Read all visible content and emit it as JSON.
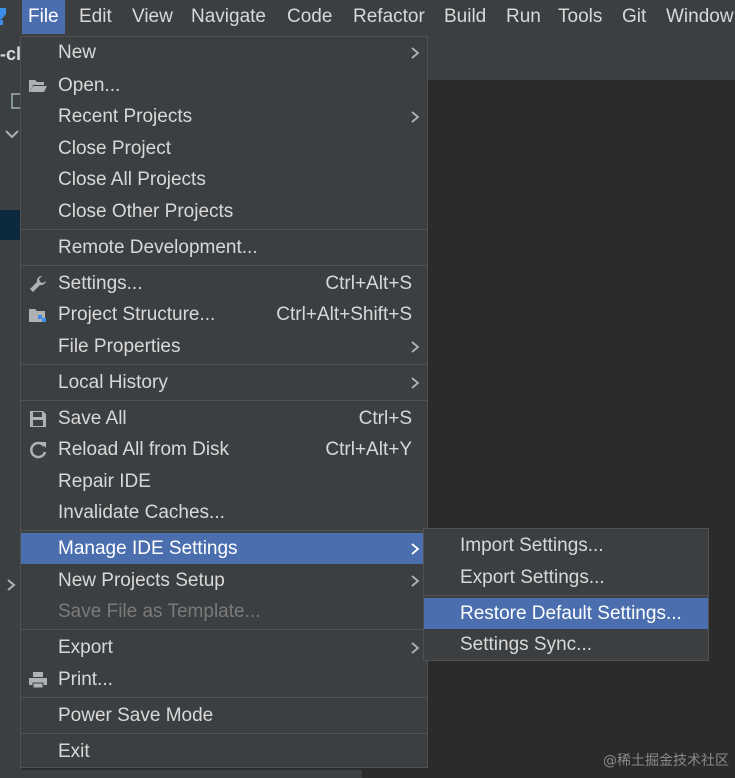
{
  "menubar": {
    "items": [
      {
        "label": "File",
        "active": true
      },
      {
        "label": "Edit"
      },
      {
        "label": "View"
      },
      {
        "label": "Navigate"
      },
      {
        "label": "Code"
      },
      {
        "label": "Refactor"
      },
      {
        "label": "Build"
      },
      {
        "label": "Run"
      },
      {
        "label": "Tools"
      },
      {
        "label": "Git"
      },
      {
        "label": "Window"
      }
    ]
  },
  "project": {
    "label": "-cl"
  },
  "file_menu": {
    "items": [
      {
        "label": "New",
        "submenu": true
      },
      {
        "label": "Open...",
        "icon": "folder-open-icon"
      },
      {
        "label": "Recent Projects",
        "submenu": true
      },
      {
        "label": "Close Project"
      },
      {
        "label": "Close All Projects"
      },
      {
        "label": "Close Other Projects"
      },
      {
        "label": "Remote Development..."
      },
      {
        "label": "Settings...",
        "shortcut": "Ctrl+Alt+S",
        "icon": "wrench-icon"
      },
      {
        "label": "Project Structure...",
        "shortcut": "Ctrl+Alt+Shift+S",
        "icon": "project-structure-icon"
      },
      {
        "label": "File Properties",
        "submenu": true
      },
      {
        "label": "Local History",
        "submenu": true
      },
      {
        "label": "Save All",
        "shortcut": "Ctrl+S",
        "icon": "floppy-disk-icon"
      },
      {
        "label": "Reload All from Disk",
        "shortcut": "Ctrl+Alt+Y",
        "icon": "reload-icon"
      },
      {
        "label": "Repair IDE"
      },
      {
        "label": "Invalidate Caches..."
      },
      {
        "label": "Manage IDE Settings",
        "submenu": true,
        "highlighted": true
      },
      {
        "label": "New Projects Setup",
        "submenu": true
      },
      {
        "label": "Save File as Template...",
        "disabled": true
      },
      {
        "label": "Export",
        "submenu": true
      },
      {
        "label": "Print...",
        "icon": "printer-icon"
      },
      {
        "label": "Power Save Mode"
      },
      {
        "label": "Exit"
      }
    ]
  },
  "manage_ide_settings_submenu": {
    "items": [
      {
        "label": "Import Settings..."
      },
      {
        "label": "Export Settings..."
      },
      {
        "label": "Restore Default Settings...",
        "highlighted": true
      },
      {
        "label": "Settings Sync..."
      }
    ]
  },
  "colors": {
    "menu_background": "#3c3f41",
    "highlight": "#4b6eaf",
    "text": "#d8d8d8",
    "disabled_text": "#7a7a7a",
    "editor_background": "#2b2b2b"
  },
  "watermark": {
    "text": "@稀土掘金技术社区"
  }
}
